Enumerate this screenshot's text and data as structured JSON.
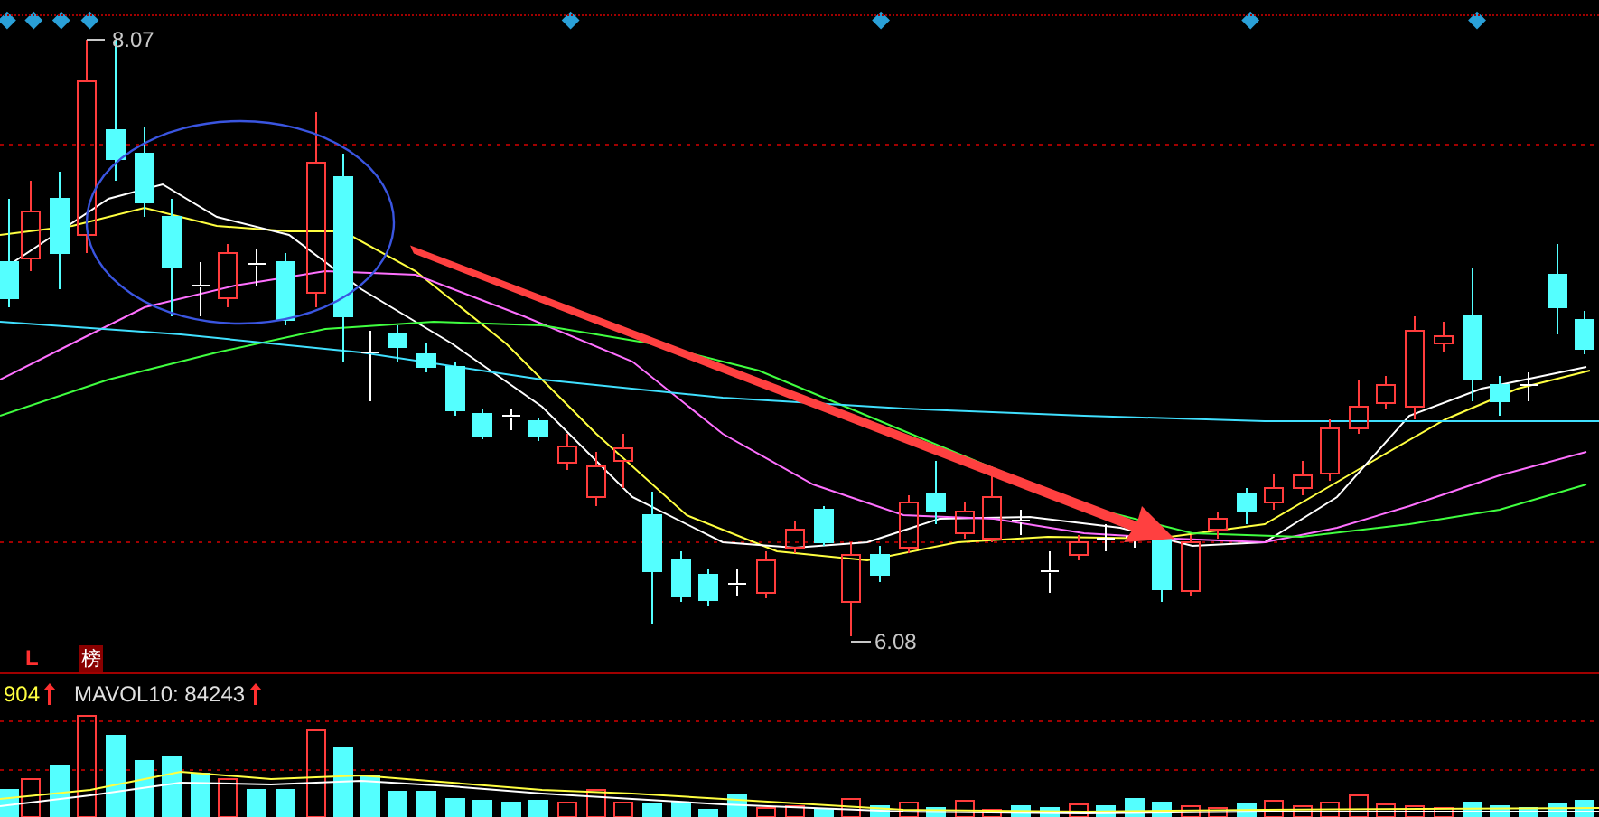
{
  "chart": {
    "high_label": "8.07",
    "low_label": "6.08",
    "markers": [
      {
        "kind": "letter",
        "text": "L"
      },
      {
        "kind": "badge",
        "text": "榜"
      }
    ]
  },
  "volume": {
    "labels": [
      {
        "kind": "value",
        "text": "904"
      },
      {
        "kind": "average",
        "text": "MAVOL10: 84243"
      }
    ]
  }
}
